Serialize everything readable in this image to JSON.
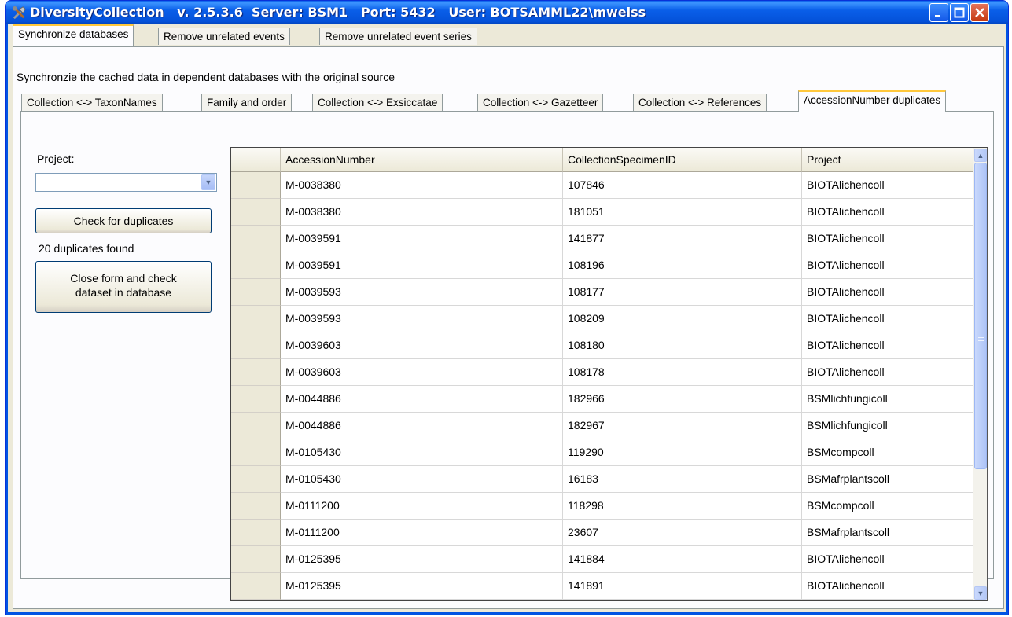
{
  "window": {
    "title": "DiversityCollection   v. 2.5.3.6  Server: BSM1   Port: 5432   User: BOTSAMML22\\mweiss"
  },
  "top_tabs": [
    {
      "label": "Synchronize databases",
      "active": true
    },
    {
      "label": "Remove unrelated events",
      "active": false
    },
    {
      "label": "Remove unrelated event series",
      "active": false
    }
  ],
  "description": "Synchronzie the cached data in dependent databases with the original source",
  "sub_tabs": [
    {
      "label": "Collection <-> TaxonNames"
    },
    {
      "label": "Family and order"
    },
    {
      "label": "Collection <-> Exsiccatae"
    },
    {
      "label": "Collection <-> Gazetteer"
    },
    {
      "label": "Collection <-> References"
    },
    {
      "label": "AccessionNumber duplicates"
    }
  ],
  "left_panel": {
    "project_label": "Project:",
    "project_value": "",
    "check_button": "Check for duplicates",
    "status": "20 duplicates found",
    "close_button_line1": "Close form and check",
    "close_button_line2": "dataset in database"
  },
  "grid": {
    "columns": [
      "AccessionNumber",
      "CollectionSpecimenID",
      "Project"
    ],
    "rows": [
      [
        "M-0038380",
        "107846",
        "BIOTAlichencoll"
      ],
      [
        "M-0038380",
        "181051",
        "BIOTAlichencoll"
      ],
      [
        "M-0039591",
        "141877",
        "BIOTAlichencoll"
      ],
      [
        "M-0039591",
        "108196",
        "BIOTAlichencoll"
      ],
      [
        "M-0039593",
        "108177",
        "BIOTAlichencoll"
      ],
      [
        "M-0039593",
        "108209",
        "BIOTAlichencoll"
      ],
      [
        "M-0039603",
        "108180",
        "BIOTAlichencoll"
      ],
      [
        "M-0039603",
        "108178",
        "BIOTAlichencoll"
      ],
      [
        "M-0044886",
        "182966",
        "BSMlichfungicoll"
      ],
      [
        "M-0044886",
        "182967",
        "BSMlichfungicoll"
      ],
      [
        "M-0105430",
        "119290",
        "BSMcompcoll"
      ],
      [
        "M-0105430",
        "16183",
        "BSMafrplantscoll"
      ],
      [
        "M-0111200",
        "118298",
        "BSMcompcoll"
      ],
      [
        "M-0111200",
        "23607",
        "BSMafrplantscoll"
      ],
      [
        "M-0125395",
        "141884",
        "BIOTAlichencoll"
      ],
      [
        "M-0125395",
        "141891",
        "BIOTAlichencoll"
      ]
    ]
  }
}
